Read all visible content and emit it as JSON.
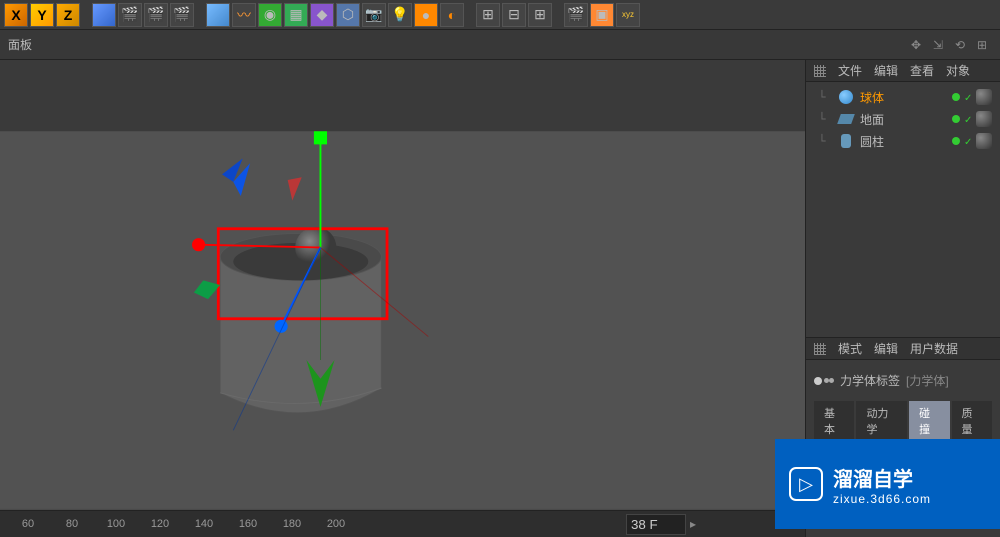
{
  "toolbar": {
    "axis_x": "X",
    "axis_y": "Y",
    "axis_z": "Z"
  },
  "menu_bar": {
    "panel_label": "面板"
  },
  "object_panel": {
    "menu": {
      "file": "文件",
      "edit": "编辑",
      "view": "查看",
      "object": "对象"
    },
    "items": [
      {
        "name": "球体",
        "selected": true
      },
      {
        "name": "地面",
        "selected": false
      },
      {
        "name": "圆柱",
        "selected": false
      }
    ]
  },
  "attr_panel": {
    "menu": {
      "mode": "模式",
      "edit": "编辑",
      "userdata": "用户数据"
    },
    "tag_title": "力学体标签",
    "tag_sub": "[力学体]",
    "tabs": {
      "basic": "基本",
      "dyn": "动力学",
      "coll": "碰撞",
      "mass": "质量"
    }
  },
  "timeline": {
    "ticks": [
      "60",
      "80",
      "100",
      "120",
      "140",
      "160",
      "180",
      "200"
    ],
    "frame_value": "38 F"
  },
  "watermark": {
    "title": "溜溜自学",
    "url": "zixue.3d66.com"
  }
}
